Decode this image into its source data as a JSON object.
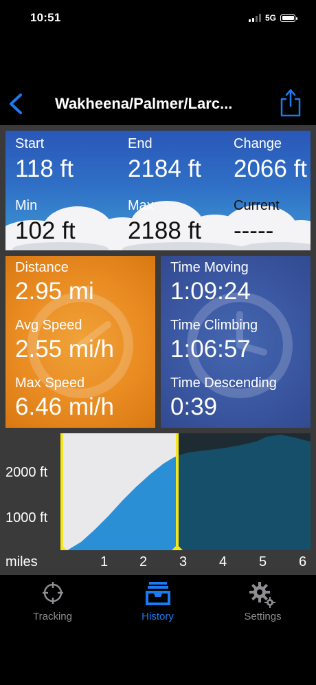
{
  "status_bar": {
    "time": "10:51",
    "network": "5G"
  },
  "nav": {
    "title": "Wakheena/Palmer/Larc..."
  },
  "elevation": {
    "start_label": "Start",
    "start_value": "118 ft",
    "end_label": "End",
    "end_value": "2184 ft",
    "change_label": "Change",
    "change_value": "2066 ft",
    "min_label": "Min",
    "min_value": "102 ft",
    "max_label": "Max",
    "max_value": "2188 ft",
    "current_label": "Current",
    "current_value": "-----"
  },
  "distance_panel": {
    "distance_label": "Distance",
    "distance_value": "2.95 mi",
    "avg_speed_label": "Avg Speed",
    "avg_speed_value": "2.55 mi/h",
    "max_speed_label": "Max Speed",
    "max_speed_value": "6.46 mi/h"
  },
  "time_panel": {
    "moving_label": "Time Moving",
    "moving_value": "1:09:24",
    "climbing_label": "Time Climbing",
    "climbing_value": "1:06:57",
    "descending_label": "Time Descending",
    "descending_value": "0:39"
  },
  "chart": {
    "y_labels": [
      "2000 ft",
      "1000 ft"
    ],
    "x_unit_label": "miles",
    "x_labels": [
      "1",
      "2",
      "3",
      "4",
      "5",
      "6"
    ],
    "selection_end_mile": 2.95,
    "colors": {
      "selected_fill": "#2b8fd6",
      "unselected_fill": "#154f6a",
      "highlight_bg": "#e9e9ec",
      "handle": "#f5e51f"
    }
  },
  "tabs": [
    {
      "label": "Tracking",
      "icon": "crosshair-icon",
      "active": false
    },
    {
      "label": "History",
      "icon": "inbox-tray-icon",
      "active": true
    },
    {
      "label": "Settings",
      "icon": "gears-icon",
      "active": false
    }
  ],
  "colors": {
    "accent": "#1a7cf0",
    "inactive_tab": "#8e8e93"
  }
}
